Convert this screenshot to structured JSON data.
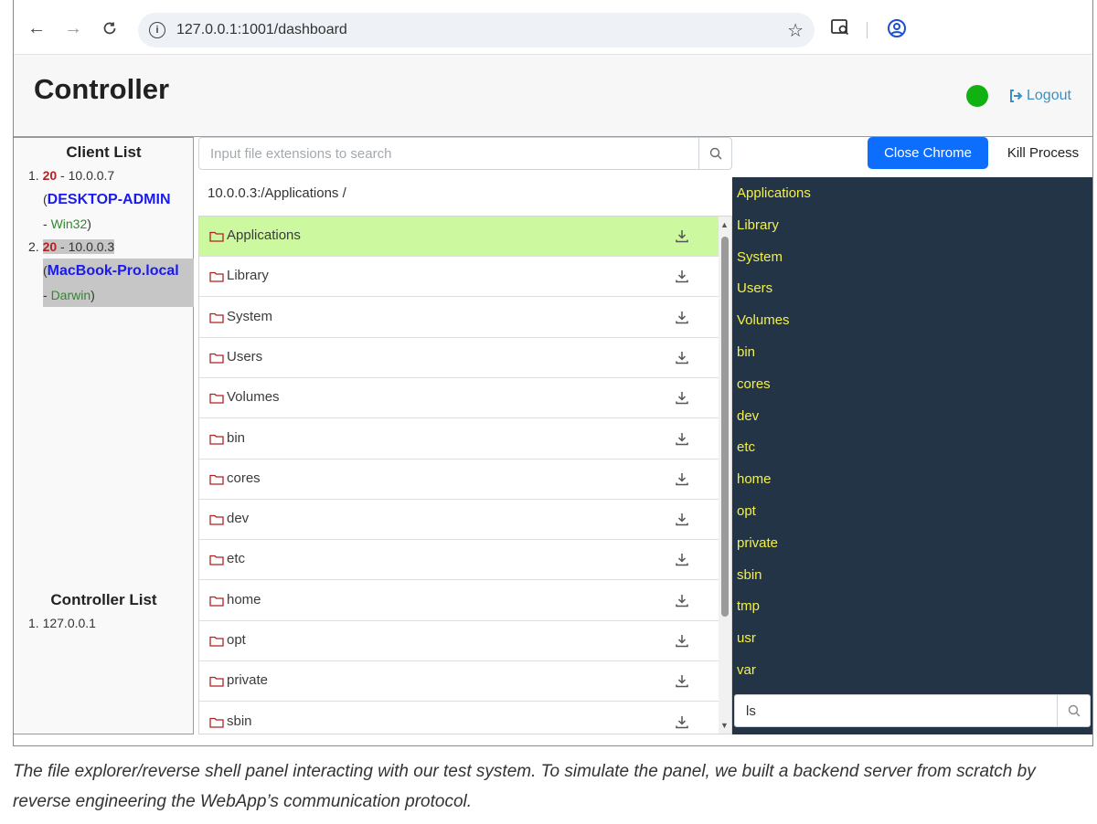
{
  "browser": {
    "url": "127.0.0.1:1001/dashboard"
  },
  "app": {
    "title": "Controller",
    "logout_label": "Logout",
    "status_color": "#12b112"
  },
  "sidebar": {
    "client_list_title": "Client List",
    "clients": [
      {
        "index": "1.",
        "count": "20",
        "ip": "10.0.0.7",
        "host": "DESKTOP-ADMIN",
        "os": "Win32",
        "selected": false
      },
      {
        "index": "2.",
        "count": "20",
        "ip": "10.0.0.3",
        "host": "MacBook-Pro.local",
        "os": "Darwin",
        "selected": true
      }
    ],
    "controller_list_title": "Controller List",
    "controllers": [
      "1. 127.0.0.1"
    ]
  },
  "file_panel": {
    "search_placeholder": "Input file extensions to search",
    "current_path": "10.0.0.3:/Applications /",
    "files": [
      "Applications",
      "Library",
      "System",
      "Users",
      "Volumes",
      "bin",
      "cores",
      "dev",
      "etc",
      "home",
      "opt",
      "private",
      "sbin"
    ],
    "active_file": "Applications",
    "active_color": "#ccf8a0"
  },
  "shell_panel": {
    "close_chrome_label": "Close Chrome",
    "kill_process_label": "Kill Process",
    "output_lines": [
      "Applications",
      "Library",
      "System",
      "Users",
      "Volumes",
      "bin",
      "cores",
      "dev",
      "etc",
      "home",
      "opt",
      "private",
      "sbin",
      "tmp",
      "usr",
      "var"
    ],
    "command_value": "ls",
    "background_color": "#233446",
    "text_color": "#f3f04a"
  },
  "caption": "The file explorer/reverse shell panel interacting with our test system. To simulate the panel, we built a backend server from scratch by reverse engineering the WebApp’s communication protocol."
}
